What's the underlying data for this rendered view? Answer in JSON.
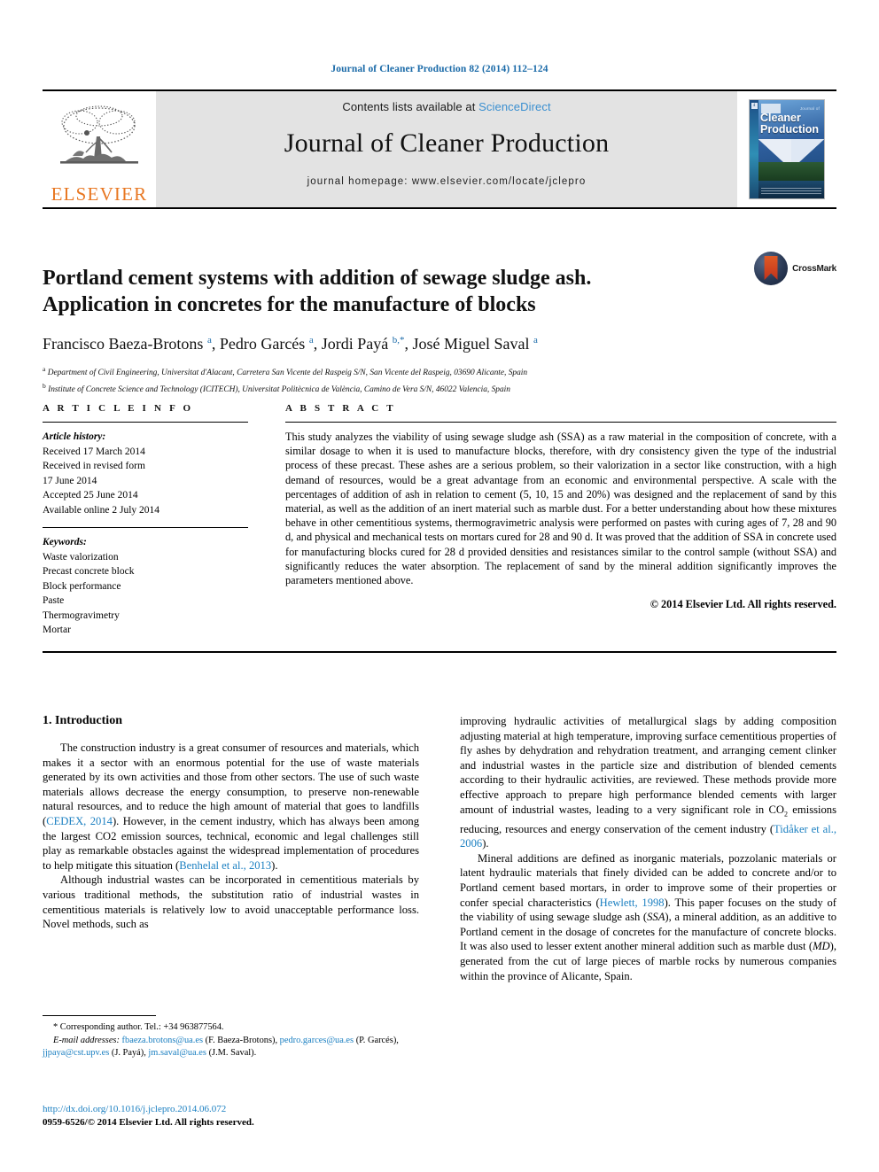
{
  "running_head": "Journal of Cleaner Production 82 (2014) 112–124",
  "masthead": {
    "contents_prefix": "Contents lists available at ",
    "sciencedirect": "ScienceDirect",
    "journal_title": "Journal of Cleaner Production",
    "homepage": "journal homepage: www.elsevier.com/locate/jclepro",
    "publisher": "ELSEVIER",
    "cover": {
      "small_top": "Journal of",
      "title_line1": "Cleaner",
      "title_line2": "Production",
      "badge": "4"
    },
    "colors": {
      "link": "#3a8fd0",
      "elsevier_orange": "#E87722",
      "panel_gray": "#e3e3e3"
    }
  },
  "article": {
    "title_line1": "Portland cement systems with addition of sewage sludge ash.",
    "title_line2": "Application in concretes for the manufacture of blocks",
    "authors_html": "Francisco Baeza-Brotons <sup>a</sup>, Pedro Garcés <sup>a</sup>, Jordi Payá <sup>b,*</sup>, José Miguel Saval <sup>a</sup>",
    "affiliation_a": "Department of Civil Engineering, Universitat d'Alacant, Carretera San Vicente del Raspeig S/N, San Vicente del Raspeig, 03690 Alicante, Spain",
    "affiliation_b": "Institute of Concrete Science and Technology (ICITECH), Universitat Politècnica de València, Camino de Vera S/N, 46022 Valencia, Spain",
    "crossmark_label": "CrossMark"
  },
  "article_info": {
    "heading": "A R T I C L E   I N F O",
    "history_label": "Article history:",
    "history": [
      "Received 17 March 2014",
      "Received in revised form",
      "17 June 2014",
      "Accepted 25 June 2014",
      "Available online 2 July 2014"
    ],
    "keywords_label": "Keywords:",
    "keywords": [
      "Waste valorization",
      "Precast concrete block",
      "Block performance",
      "Paste",
      "Thermogravimetry",
      "Mortar"
    ]
  },
  "abstract": {
    "heading": "A B S T R A C T",
    "text": "This study analyzes the viability of using sewage sludge ash (SSA) as a raw material in the composition of concrete, with a similar dosage to when it is used to manufacture blocks, therefore, with dry consistency given the type of the industrial process of these precast. These ashes are a serious problem, so their valorization in a sector like construction, with a high demand of resources, would be a great advantage from an economic and environmental perspective. A scale with the percentages of addition of ash in relation to cement (5, 10, 15 and 20%) was designed and the replacement of sand by this material, as well as the addition of an inert material such as marble dust. For a better understanding about how these mixtures behave in other cementitious systems, thermogravimetric analysis were performed on pastes with curing ages of 7, 28 and 90 d, and physical and mechanical tests on mortars cured for 28 and 90 d. It was proved that the addition of SSA in concrete used for manufacturing blocks cured for 28 d provided densities and resistances similar to the control sample (without SSA) and significantly reduces the water absorption. The replacement of sand by the mineral addition significantly improves the parameters mentioned above.",
    "copyright": "© 2014 Elsevier Ltd. All rights reserved."
  },
  "body": {
    "section_heading": "1. Introduction",
    "left_paragraph_1_a": "The construction industry is a great consumer of resources and materials, which makes it a sector with an enormous potential for the use of waste materials generated by its own activities and those from other sectors. The use of such waste materials allows decrease the energy consumption, to preserve non-renewable natural resources, and to reduce the high amount of material that goes to landfills (",
    "cite_cedex": "CEDEX, 2014",
    "left_paragraph_1_b": "). However, in the cement industry, which has always been among the largest CO2 emission sources, technical, economic and legal challenges still play as remarkable obstacles against the widespread implementation of procedures to help mitigate this situation (",
    "cite_benhelal": "Benhelal et al., 2013",
    "left_paragraph_1_c": ").",
    "left_paragraph_2": "Although industrial wastes can be incorporated in cementitious materials by various traditional methods, the substitution ratio of industrial wastes in cementitious materials is relatively low to avoid unacceptable performance loss. Novel methods, such as",
    "right_paragraph_1_a": "improving hydraulic activities of metallurgical slags by adding composition adjusting material at high temperature, improving surface cementitious properties of fly ashes by dehydration and rehydration treatment, and arranging cement clinker and industrial wastes in the particle size and distribution of blended cements according to their hydraulic activities, are reviewed. These methods provide more effective approach to prepare high performance blended cements with larger amount of industrial wastes, leading to a very significant role in CO",
    "co2_sub": "2",
    "right_paragraph_1_b": " emissions reducing, resources and energy conservation of the cement industry (",
    "cite_tidaker": "Tidåker et al., 2006",
    "right_paragraph_1_c": ").",
    "right_paragraph_2_a": "Mineral additions are defined as inorganic materials, pozzolanic materials or latent hydraulic materials that finely divided can be added to concrete and/or to Portland cement based mortars, in order to improve some of their properties or confer special characteristics (",
    "cite_hewlett": "Hewlett, 1998",
    "right_paragraph_2_b": "). This paper focuses on the study of the viability of using sewage sludge ash (",
    "ital_ssa": "SSA",
    "right_paragraph_2_c": "), a mineral addition, as an additive to Portland cement in the dosage of concretes for the manufacture of concrete blocks. It was also used to lesser extent another mineral addition such as marble dust (",
    "ital_md": "MD",
    "right_paragraph_2_d": "), generated from the cut of large pieces of marble rocks by numerous companies within the province of Alicante, Spain."
  },
  "footnotes": {
    "corresponding": "* Corresponding author. Tel.: +34 963877564.",
    "email_label": "E-mail addresses:",
    "email1": "fbaeza.brotons@ua.es",
    "email1_who": " (F. Baeza-Brotons), ",
    "email2": "pedro.garces@ua.es",
    "email2_who": " (P. Garcés), ",
    "email3": "jjpaya@cst.upv.es",
    "email3_who": " (J. Payá), ",
    "email4": "jm.saval@ua.es",
    "email4_who": " (J.M. Saval).",
    "doi": "http://dx.doi.org/10.1016/j.jclepro.2014.06.072",
    "issn": "0959-6526/© 2014 Elsevier Ltd. All rights reserved."
  }
}
